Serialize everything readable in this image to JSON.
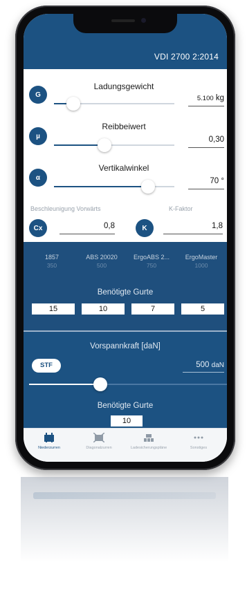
{
  "header": {
    "title": "VDI 2700 2:2014"
  },
  "sliders": [
    {
      "symbol": "G",
      "label": "Ladungsgewicht",
      "value": "5.100",
      "unit": "kg",
      "level": 0.16
    },
    {
      "symbol": "µ",
      "label": "Reibbeiwert",
      "value": "0,30",
      "unit": "",
      "level": 0.42
    },
    {
      "symbol": "α",
      "label": "Vertikalwinkel",
      "value": "70",
      "unit": "°",
      "level": 0.78
    }
  ],
  "factors": {
    "cx_label": "Beschleunigung Vorwärts",
    "cx_symbol": "Cx",
    "cx_value": "0,8",
    "k_label": "K-Faktor",
    "k_symbol": "K",
    "k_value": "1,8"
  },
  "belts": {
    "columns": [
      {
        "name": "1857",
        "sub": "350"
      },
      {
        "name": "ABS 20020",
        "sub": "500"
      },
      {
        "name": "ErgoABS 2...",
        "sub": "750"
      },
      {
        "name": "ErgoMaster",
        "sub": "1000"
      }
    ],
    "required_title": "Benötigte Gurte",
    "required_values": [
      "15",
      "10",
      "7",
      "5"
    ]
  },
  "pretension": {
    "title": "Vorspannkraft [daN]",
    "button": "STF",
    "value": "500",
    "unit": "daN",
    "level": 0.36,
    "required_title": "Benötigte Gurte",
    "required_value": "10"
  },
  "tabs": [
    {
      "label": "Niederzurren",
      "icon": "lashing-icon",
      "active": true
    },
    {
      "label": "Diagonalzurren",
      "icon": "diagonal-lashing-icon",
      "active": false
    },
    {
      "label": "Ladesicherungspläne",
      "icon": "load-plan-icon",
      "active": false
    },
    {
      "label": "Sonstiges",
      "icon": "more-icon",
      "active": false
    }
  ],
  "colors": {
    "primary": "#1c5282",
    "belt_panel": "#1f4f7d",
    "background": "#ffffff"
  }
}
